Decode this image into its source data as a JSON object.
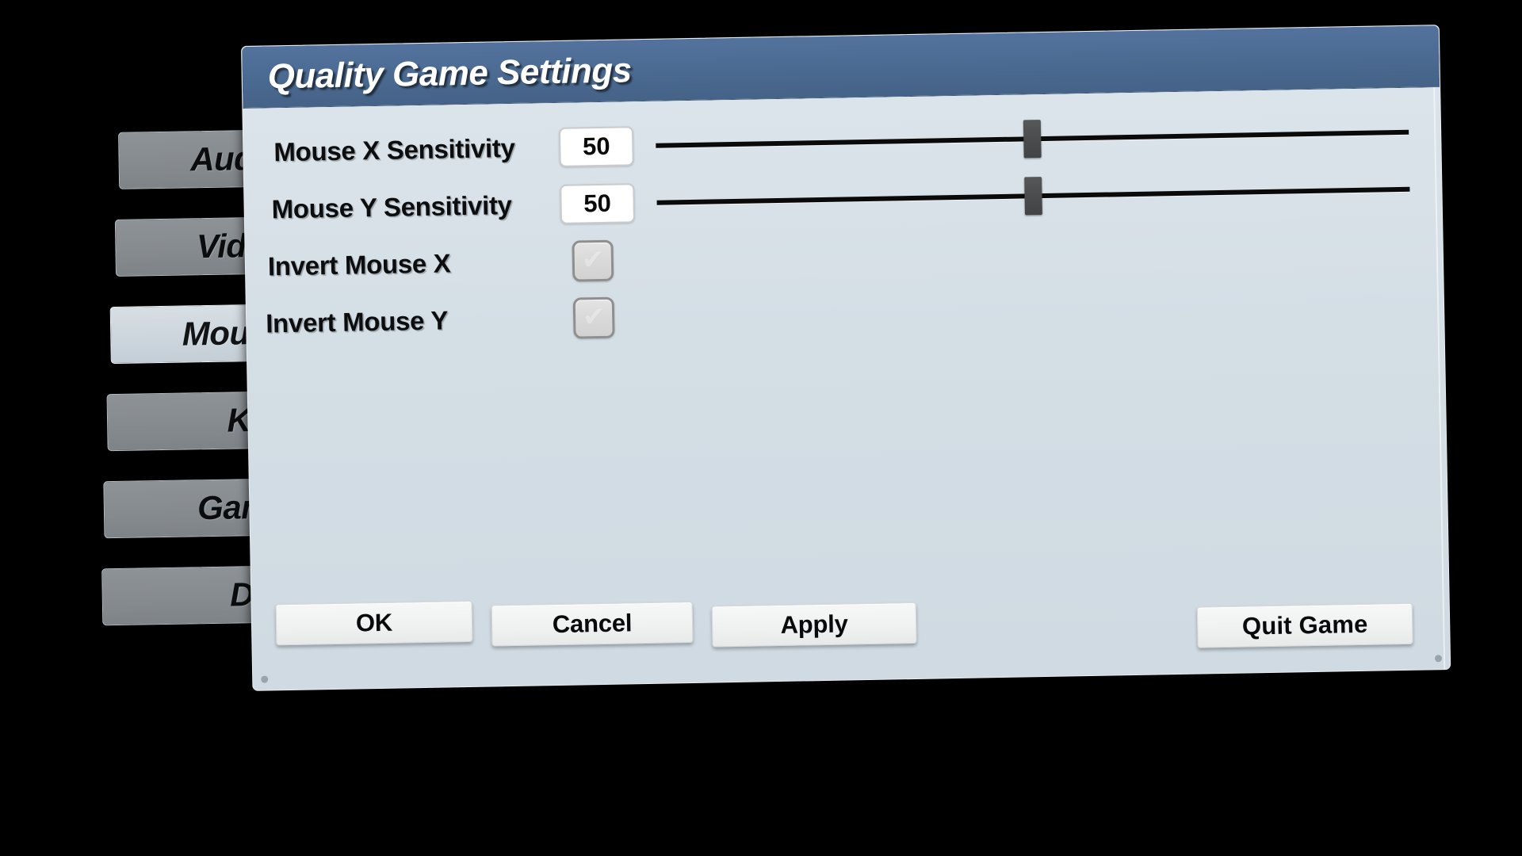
{
  "window": {
    "title": "Quality Game Settings",
    "titlebar_color": "#4a6990",
    "panel_color": "#d5e0e7"
  },
  "sidebar": {
    "items": [
      {
        "label": "Audio",
        "selected": false
      },
      {
        "label": "Video",
        "selected": false
      },
      {
        "label": "Mouse",
        "selected": true
      },
      {
        "label": "Key",
        "selected": false
      },
      {
        "label": "Game",
        "selected": false
      },
      {
        "label": "Dev",
        "selected": false
      }
    ]
  },
  "settings": {
    "rows": [
      {
        "label": "Mouse X Sensitivity",
        "type": "slider",
        "value": "50",
        "slider_percent": 50
      },
      {
        "label": "Mouse Y Sensitivity",
        "type": "slider",
        "value": "50",
        "slider_percent": 50
      },
      {
        "label": "Invert Mouse X",
        "type": "checkbox",
        "checked": false,
        "glyph": "✔"
      },
      {
        "label": "Invert Mouse Y",
        "type": "checkbox",
        "checked": false,
        "glyph": "✔"
      }
    ]
  },
  "footer": {
    "ok_label": "OK",
    "cancel_label": "Cancel",
    "apply_label": "Apply",
    "quit_label": "Quit Game"
  }
}
